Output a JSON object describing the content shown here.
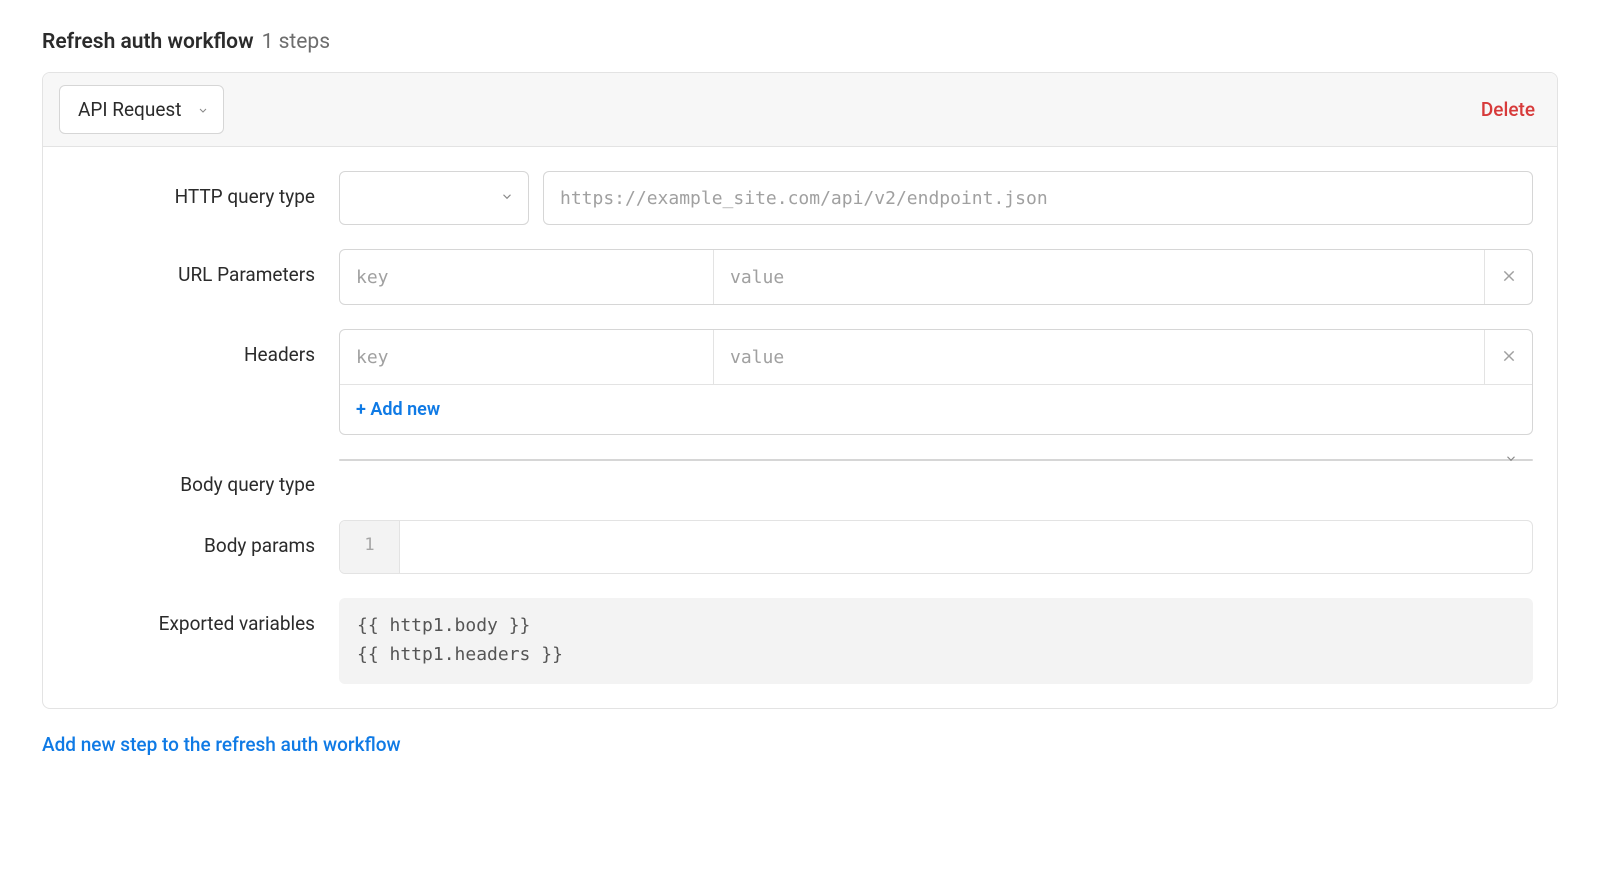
{
  "header": {
    "title": "Refresh auth workflow",
    "steps_label": "1 steps"
  },
  "step": {
    "type_label": "API Request",
    "delete_label": "Delete",
    "fields": {
      "http_query_type": {
        "label": "HTTP query type",
        "method_value": "",
        "url_placeholder": "https://example_site.com/api/v2/endpoint.json",
        "url_value": ""
      },
      "url_parameters": {
        "label": "URL Parameters",
        "key_placeholder": "key",
        "value_placeholder": "value",
        "key_value": "",
        "value_value": ""
      },
      "headers": {
        "label": "Headers",
        "key_placeholder": "key",
        "value_placeholder": "value",
        "key_value": "",
        "value_value": "",
        "add_new_label": "+ Add new"
      },
      "body_query_type": {
        "label": "Body query type",
        "value": ""
      },
      "body_params": {
        "label": "Body params",
        "gutter": "1",
        "content": ""
      },
      "exported_variables": {
        "label": "Exported variables",
        "line1": "{{ http1.body }}",
        "line2": "{{ http1.headers }}"
      }
    }
  },
  "footer": {
    "add_step_label": "Add new step to the refresh auth workflow"
  }
}
